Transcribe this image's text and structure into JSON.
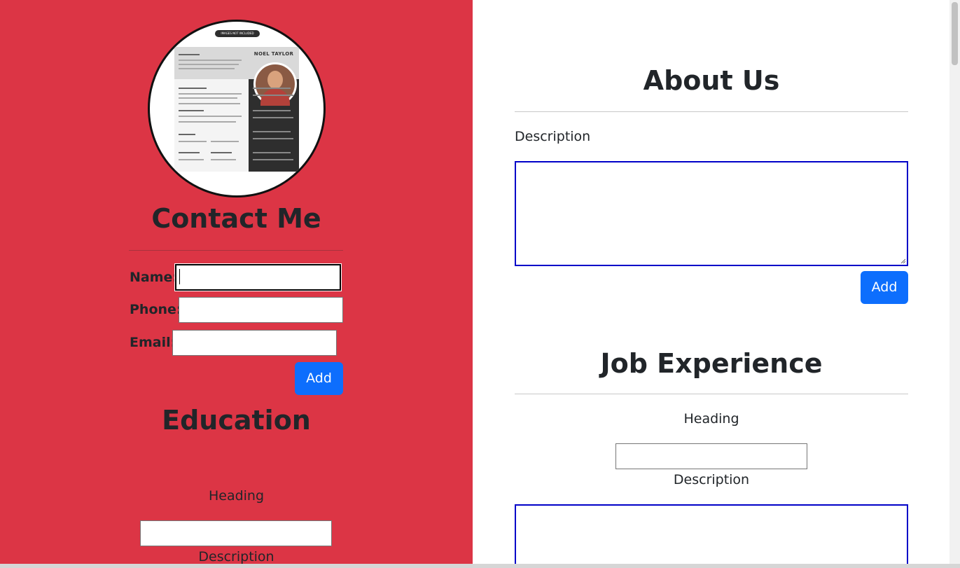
{
  "profile": {
    "badge_text": "IMAGES NOT INCLUDED",
    "resume_name": "NOEL TAYLOR"
  },
  "contact": {
    "heading": "Contact Me",
    "name_label": "Name:",
    "phone_label": "Phone:",
    "email_label": "Email:",
    "name_value": "",
    "phone_value": "",
    "email_value": "",
    "add_label": "Add"
  },
  "education": {
    "heading": "Education",
    "heading_label": "Heading",
    "description_label": "Description",
    "heading_value": ""
  },
  "about": {
    "heading": "About Us",
    "description_label": "Description",
    "description_value": "",
    "add_label": "Add"
  },
  "job": {
    "heading": "Job Experience",
    "heading_label": "Heading",
    "description_label": "Description",
    "heading_value": "",
    "description_value": ""
  },
  "colors": {
    "left_panel": "#dc3545",
    "button": "#0d6efd",
    "textarea_border": "#0000c8"
  }
}
